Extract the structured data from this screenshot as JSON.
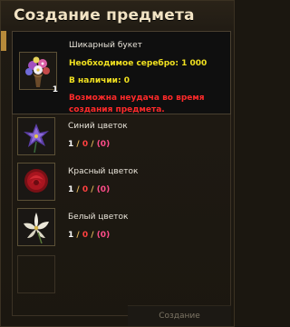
{
  "window": {
    "title": "Создание предмета"
  },
  "result": {
    "name": "Шикарный букет",
    "silver_label": "Необходимое серебро: 1 000",
    "have_label": "В наличии: 0",
    "warning": "Возможна неудача во время создания предмета.",
    "quantity": "1",
    "icon": "flower-bouquet-icon"
  },
  "ingredients": [
    {
      "name": "Синий цветок",
      "have": "1",
      "sep": "/",
      "need": "0",
      "paren": "(0)",
      "icon": "blue-flower-icon"
    },
    {
      "name": "Красный цветок",
      "have": "1",
      "sep": "/",
      "need": "0",
      "paren": "(0)",
      "icon": "red-rose-icon"
    },
    {
      "name": "Белый цветок",
      "have": "1",
      "sep": "/",
      "need": "0",
      "paren": "(0)",
      "icon": "white-lily-icon"
    }
  ],
  "buttons": {
    "create": "Создание"
  },
  "colors": {
    "accent": "#b78a3a",
    "warning": "#ff2a2a",
    "silver": "#f0e020"
  }
}
